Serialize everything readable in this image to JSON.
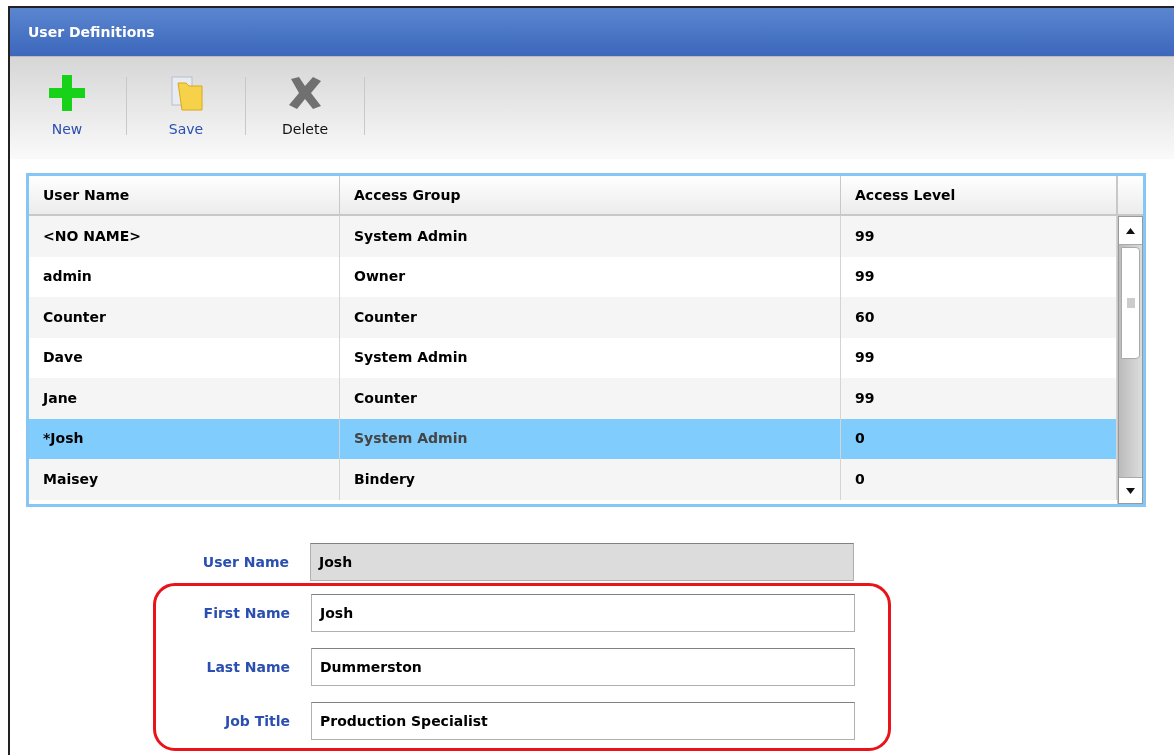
{
  "window": {
    "title": "User Definitions"
  },
  "toolbar": [
    {
      "label": "New",
      "kind": "new",
      "color": "#2a4fb0"
    },
    {
      "label": "Save",
      "kind": "save",
      "color": "#2a4fb0"
    },
    {
      "label": "Delete",
      "kind": "delete",
      "color": "#111111"
    }
  ],
  "table": {
    "columns": [
      "User Name",
      "Access Group",
      "Access Level"
    ],
    "rows": [
      {
        "cells": [
          "<NO NAME>",
          "System Admin",
          "99"
        ],
        "selected": false
      },
      {
        "cells": [
          "admin",
          "Owner",
          "99"
        ],
        "selected": false
      },
      {
        "cells": [
          "Counter",
          "Counter",
          "60"
        ],
        "selected": false
      },
      {
        "cells": [
          "Dave",
          "System Admin",
          "99"
        ],
        "selected": false
      },
      {
        "cells": [
          "Jane",
          "Counter",
          "99"
        ],
        "selected": false
      },
      {
        "cells": [
          "*Josh",
          "System Admin",
          "0"
        ],
        "selected": true
      },
      {
        "cells": [
          "Maisey",
          "Bindery",
          "0"
        ],
        "selected": false
      }
    ]
  },
  "form": [
    {
      "label": "User Name",
      "value": "Josh",
      "disabled": true,
      "highlighted": false
    },
    {
      "label": "First Name",
      "value": "Josh",
      "disabled": false,
      "highlighted": true
    },
    {
      "label": "Last Name",
      "value": "Dummerston",
      "disabled": false,
      "highlighted": true
    },
    {
      "label": "Job Title",
      "value": "Production Specialist",
      "disabled": false,
      "highlighted": true
    }
  ]
}
